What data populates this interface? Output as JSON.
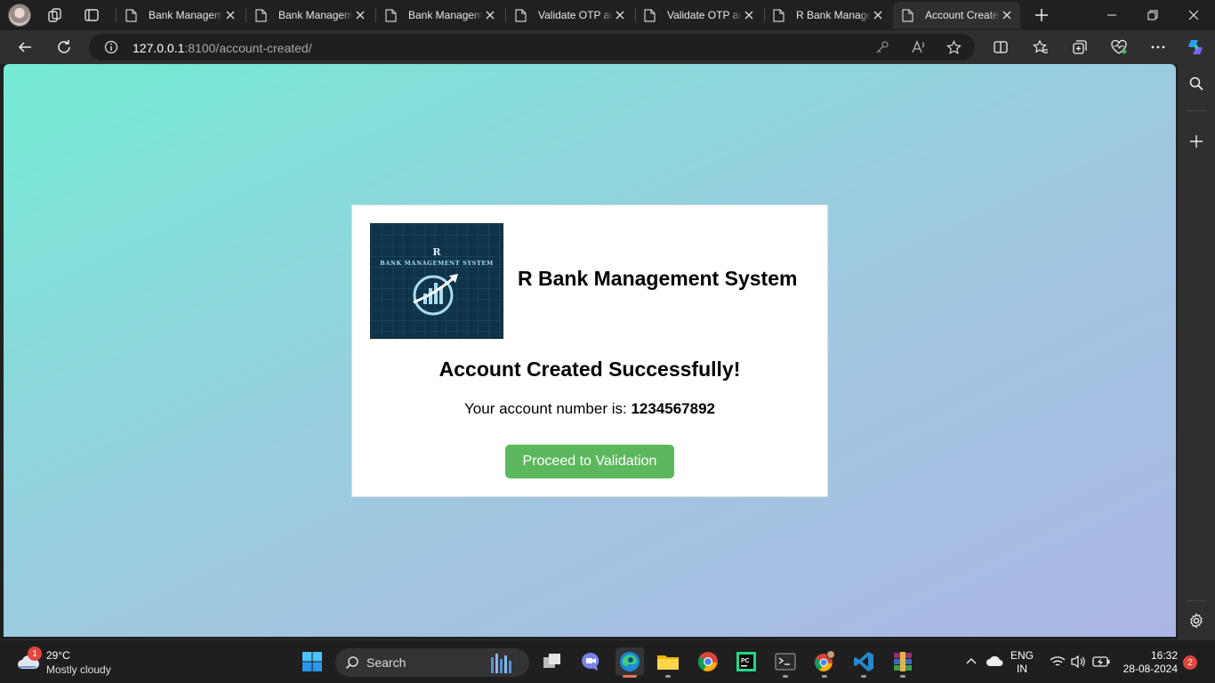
{
  "browser": {
    "tabs": [
      {
        "title": "Bank Management",
        "active": false
      },
      {
        "title": "Bank Management",
        "active": false
      },
      {
        "title": "Bank Management",
        "active": false
      },
      {
        "title": "Validate OTP and",
        "active": false
      },
      {
        "title": "Validate OTP and",
        "active": false
      },
      {
        "title": "R Bank Management",
        "active": false
      },
      {
        "title": "Account Created",
        "active": true
      }
    ],
    "address": {
      "host": "127.0.0.1",
      "path": ":8100/account-created/"
    }
  },
  "page": {
    "logo": {
      "letter": "R",
      "text": "BANK MANAGEMENT SYSTEM"
    },
    "brand_title": "R Bank Management System",
    "headline": "Account Created Successfully!",
    "account_label": "Your account number is:",
    "account_number": "1234567892",
    "proceed_button": "Proceed to Validation",
    "colors": {
      "gradient_start": "#74ebd5",
      "gradient_end": "#acb6e5",
      "button": "#5cb85c",
      "logo_bg": "#0f3449"
    }
  },
  "taskbar": {
    "weather": {
      "temperature": "29°C",
      "condition": "Mostly cloudy",
      "badge": "1"
    },
    "search_label": "Search",
    "tray": {
      "lang_line1": "ENG",
      "lang_line2": "IN",
      "time": "16:32",
      "date": "28-08-2024",
      "notification_count": "2"
    }
  }
}
